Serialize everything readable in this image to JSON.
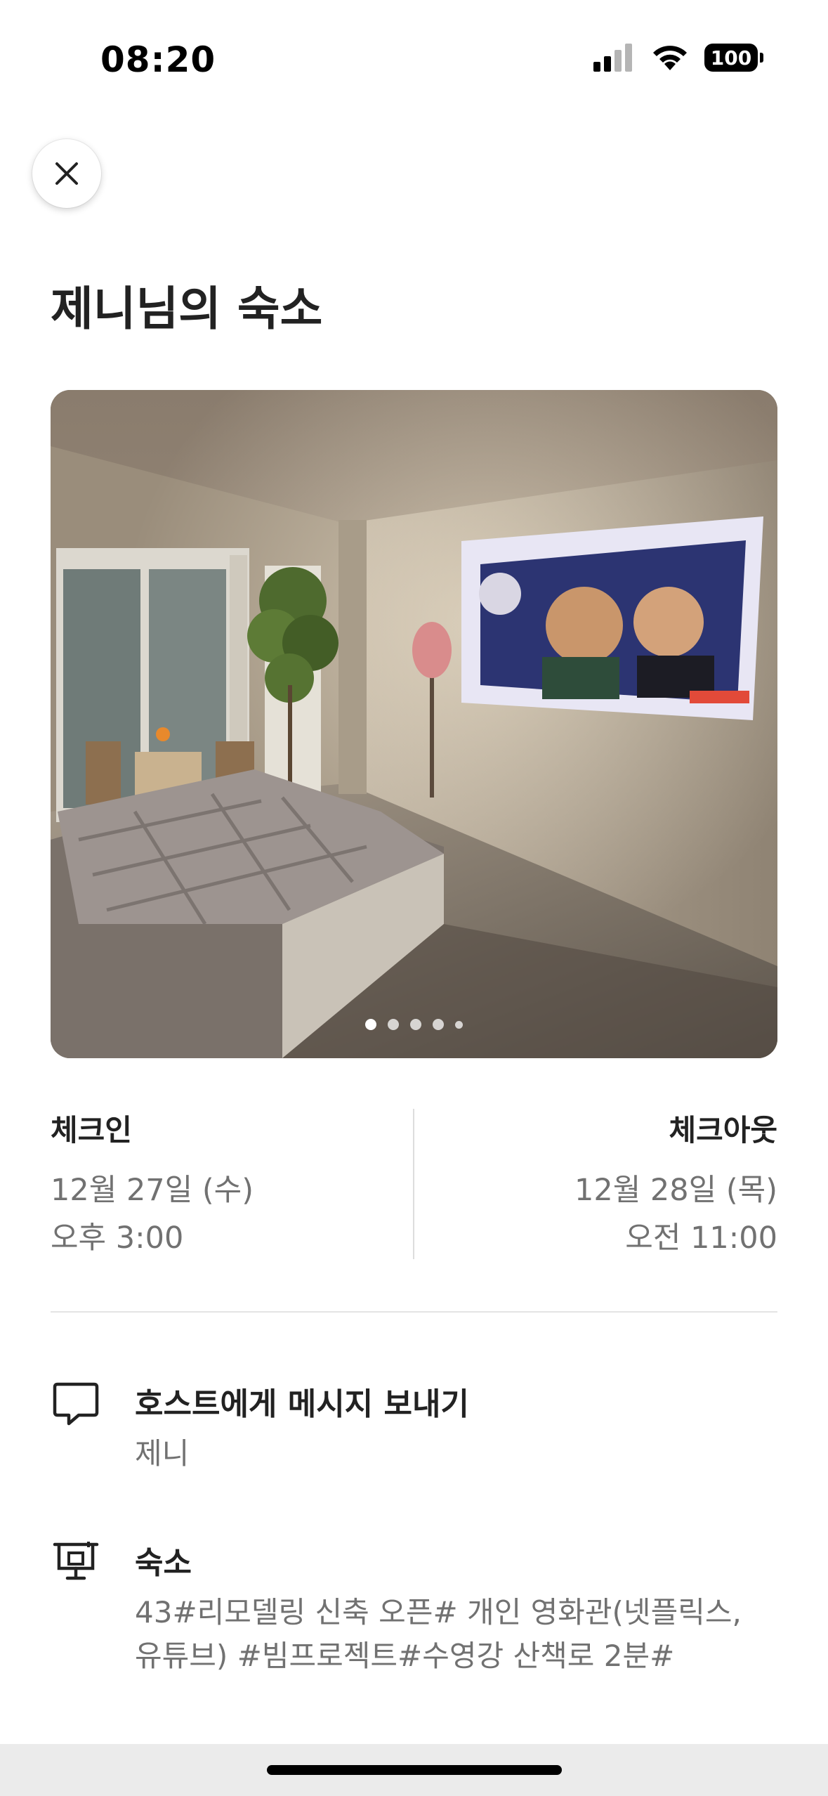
{
  "status_bar": {
    "time": "08:20",
    "battery": "100"
  },
  "listing": {
    "title": "제니님의 숙소"
  },
  "photo": {
    "total_slides": 5,
    "active_slide": 1
  },
  "checkin": {
    "label": "체크인",
    "date": "12월 27일 (수)",
    "time": "오후 3:00"
  },
  "checkout": {
    "label": "체크아웃",
    "date": "12월 28일 (목)",
    "time": "오전 11:00"
  },
  "message_host": {
    "title": "호스트에게 메시지 보내기",
    "host_name": "제니"
  },
  "accommodation": {
    "title": "숙소",
    "name": "43#리모델링 신축 오픈# 개인 영화관(넷플릭스, 유튜브) #빔프로젝트#수영강 산책로 2분#"
  },
  "icons": {
    "close": "close-icon",
    "message": "chat-bubble-icon",
    "home": "house-icon"
  }
}
